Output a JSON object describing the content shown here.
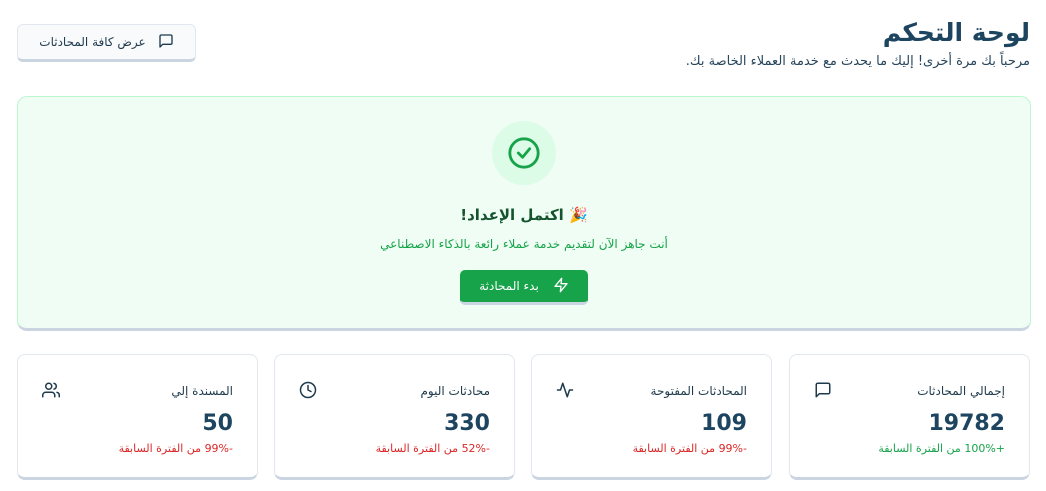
{
  "header": {
    "title": "لوحة التحكم",
    "subtitle": "مرحباً بك مرة أخرى! إليك ما يحدث مع خدمة العملاء الخاصة بك."
  },
  "toolbar": {
    "view_all_label": "عرض كافة المحادثات",
    "view_all_icon": "message-square-icon"
  },
  "banner": {
    "icon": "check-circle-icon",
    "title": "🎉 اكتمل الإعداد!",
    "description": "أنت جاهز الآن لتقديم خدمة عملاء رائعة بالذكاء الاصطناعي",
    "start_label": "بدء المحادثة",
    "start_icon": "zap-icon"
  },
  "stats": [
    {
      "label": "إجمالي المحادثات",
      "value": "19782",
      "change": "+100% من الفترة السابقة",
      "trend": "positive",
      "icon": "message-square-icon"
    },
    {
      "label": "المحادثات المفتوحة",
      "value": "109",
      "change": "-99% من الفترة السابقة",
      "trend": "negative",
      "icon": "activity-icon"
    },
    {
      "label": "محادثات اليوم",
      "value": "330",
      "change": "-52% من الفترة السابقة",
      "trend": "negative",
      "icon": "clock-icon"
    },
    {
      "label": "المسندة إلي",
      "value": "50",
      "change": "-99% من الفترة السابقة",
      "trend": "negative",
      "icon": "users-icon"
    }
  ],
  "colors": {
    "accent_green": "#16a34a",
    "banner_bg": "#f0fdf4",
    "negative": "#dc2626",
    "title": "#1e4560"
  }
}
